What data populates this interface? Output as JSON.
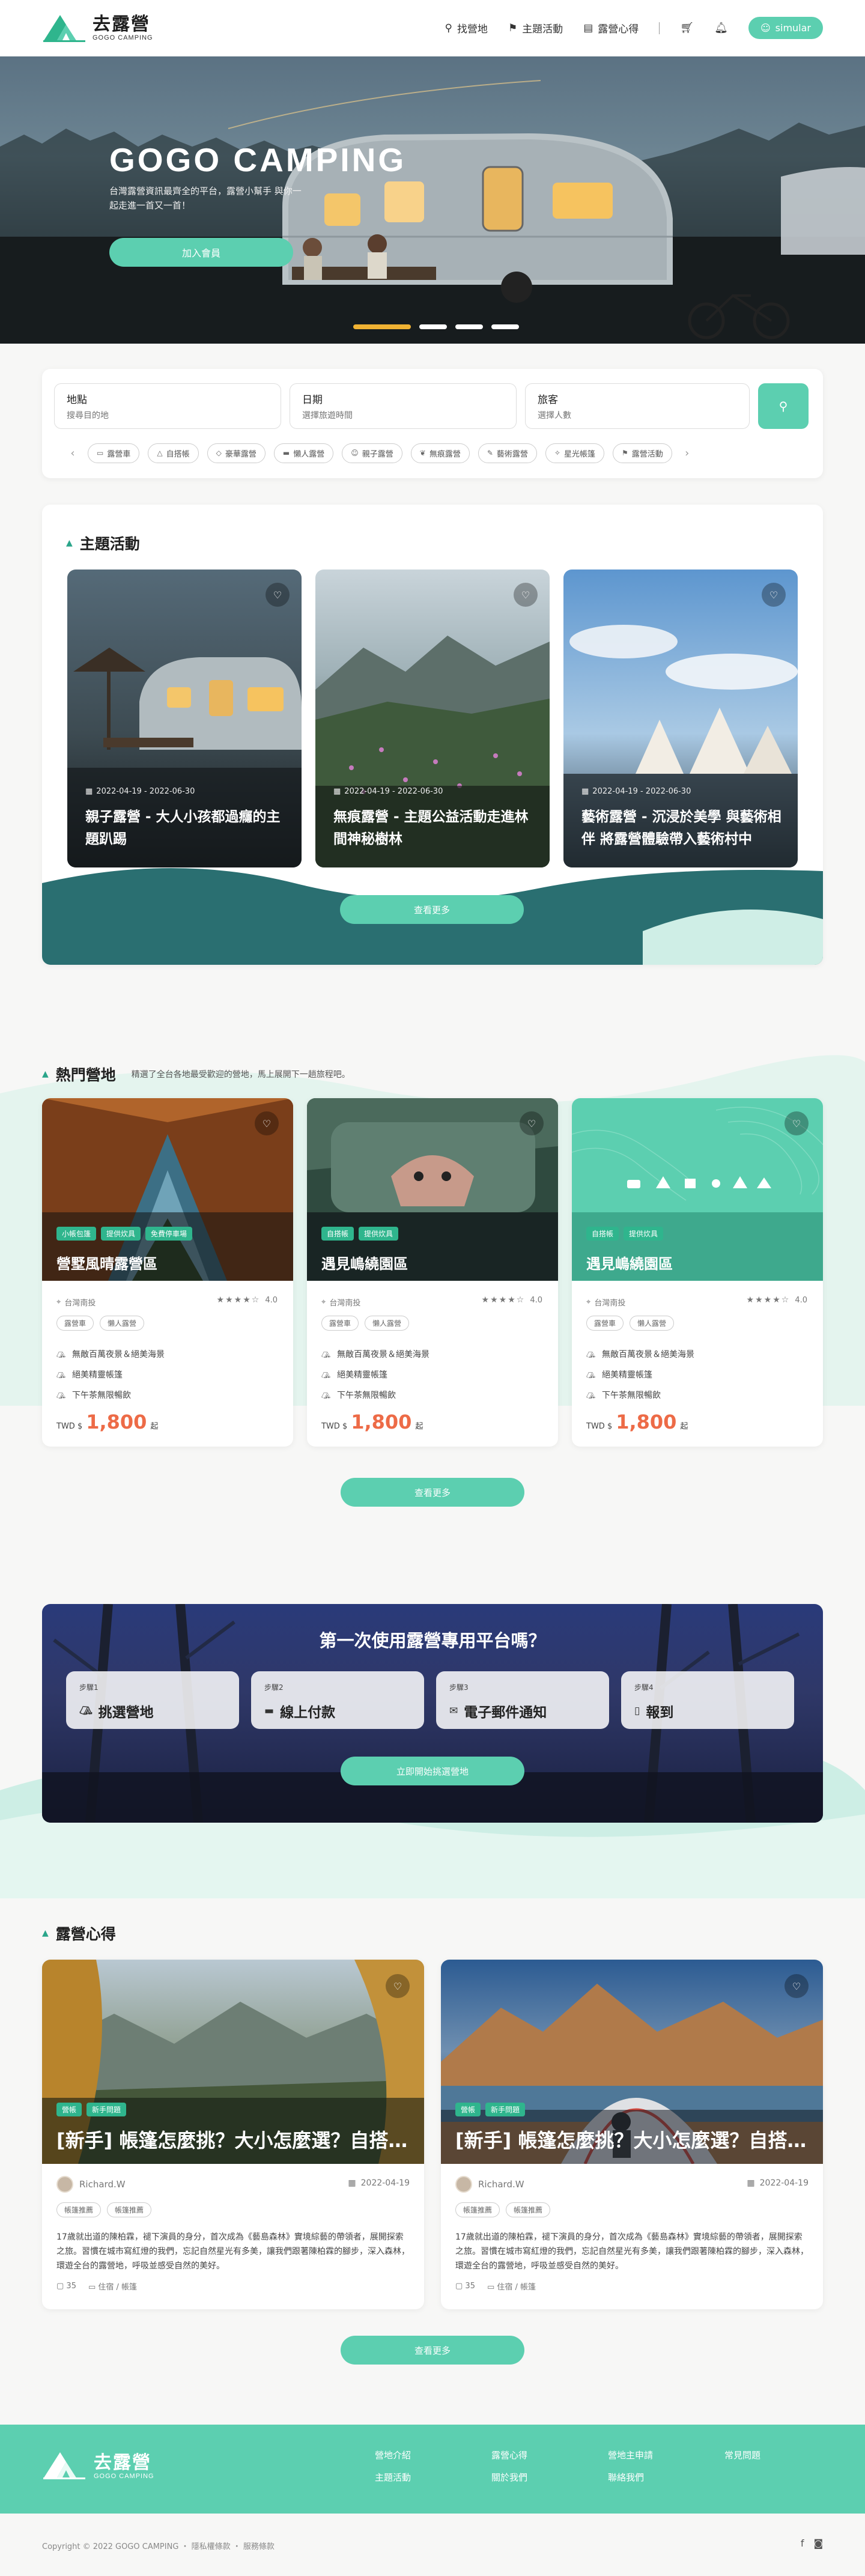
{
  "header": {
    "logo_cn": "去露營",
    "logo_en": "GOGO CAMPING",
    "nav": [
      {
        "label": "找營地",
        "icon": "user-search-icon"
      },
      {
        "label": "主題活動",
        "icon": "flag-icon"
      },
      {
        "label": "露營心得",
        "icon": "notebook-icon"
      }
    ],
    "cart_icon": "cart-icon",
    "bell_icon": "bell-icon",
    "user_label": "simular"
  },
  "hero": {
    "title": "GOGO CAMPING",
    "subtitle": "台灣露營資訊最齊全的平台，露營小幫手 與你一起走進一首又一首！",
    "button": "加入會員",
    "slides_count": 4,
    "active_slide": 1
  },
  "search": {
    "fields": [
      {
        "label": "地點",
        "placeholder": "搜尋目的地"
      },
      {
        "label": "日期",
        "placeholder": "選擇旅遊時間"
      },
      {
        "label": "旅客",
        "placeholder": "選擇人數"
      }
    ],
    "chips": [
      "露營車",
      "自搭帳",
      "豪華露營",
      "懶人露營",
      "親子露營",
      "無痕露營",
      "藝術露營",
      "星光帳篷",
      "露營活動"
    ]
  },
  "theme": {
    "title": "主題活動",
    "items": [
      {
        "date": "2022-04-19 - 2022-06-30",
        "title": "親子露營 - 大人小孩都過癮的主題趴踢"
      },
      {
        "date": "2022-04-19 - 2022-06-30",
        "title": "無痕露營 - 主題公益活動走進林間神秘樹林"
      },
      {
        "date": "2022-04-19 - 2022-06-30",
        "title": "藝術露營 - 沉浸於美學 與藝術相伴 將露營體驗帶入藝術村中"
      }
    ],
    "more": "查看更多"
  },
  "hot": {
    "title": "熱門營地",
    "note": "精選了全台各地最受歡迎的營地，馬上展開下一趟旅程吧。",
    "camps": [
      {
        "tags": [
          "小帳包篷",
          "提供炊具",
          "免費停車場"
        ],
        "name": "營墅風晴露營區",
        "location": "台灣南投",
        "rating": "4.0",
        "stars": "★★★★☆",
        "facilities": [
          "露營車",
          "懶人露營"
        ],
        "features": [
          "無敵百萬夜景＆絕美海景",
          "絕美精靈帳篷",
          "下午茶無限暢飲"
        ],
        "currency": "TWD $",
        "price": "1,800",
        "unit": "起"
      },
      {
        "tags": [
          "自搭帳",
          "提供炊具"
        ],
        "name": "遇見嶋繞園區",
        "location": "台灣南投",
        "rating": "4.0",
        "stars": "★★★★☆",
        "facilities": [
          "露營車",
          "懶人露營"
        ],
        "features": [
          "無敵百萬夜景＆絕美海景",
          "絕美精靈帳篷",
          "下午茶無限暢飲"
        ],
        "currency": "TWD $",
        "price": "1,800",
        "unit": "起"
      },
      {
        "tags": [
          "自搭帳",
          "提供炊具"
        ],
        "name": "遇見嶋繞園區",
        "location": "台灣南投",
        "rating": "4.0",
        "stars": "★★★★☆",
        "facilities": [
          "露營車",
          "懶人露營"
        ],
        "features": [
          "無敵百萬夜景＆絕美海景",
          "絕美精靈帳篷",
          "下午茶無限暢飲"
        ],
        "currency": "TWD $",
        "price": "1,800",
        "unit": "起"
      }
    ],
    "more": "查看更多"
  },
  "first_use": {
    "title": "第一次使用露營專用平台嗎？",
    "steps": [
      {
        "no": "步驟1",
        "title": "挑選營地",
        "icon": "tent-icon"
      },
      {
        "no": "步驟2",
        "title": "線上付款",
        "icon": "card-icon"
      },
      {
        "no": "步驟3",
        "title": "電子郵件通知",
        "icon": "mail-icon"
      },
      {
        "no": "步驟4",
        "title": "報到",
        "icon": "checkin-icon"
      }
    ],
    "button": "立即開始挑選營地"
  },
  "experience": {
    "title": "露營心得",
    "posts": [
      {
        "tags": [
          "營帳",
          "新手問題"
        ],
        "title": "[新手] 帳篷怎麼挑？大小怎麼選？自搭帳篷新手指南",
        "author": "Richard.W",
        "date": "2022-04-19",
        "facilities": [
          "帳篷推薦",
          "帳篷推薦"
        ],
        "body": "17歲就出道的陳柏霖，褪下演員的身分，首次成為《藝島森林》實境綜藝的帶領者，展開探索之旅。習慣在城市寫紅燈的我們，忘記自然星光有多美，讓我們跟著陳柏霖的腳步，深入森林，環遊全台的露營地，呼吸並感受自然的美好。",
        "comments": "35",
        "category": "住宿 / 帳篷"
      },
      {
        "tags": [
          "營帳",
          "新手問題"
        ],
        "title": "[新手] 帳篷怎麼挑？大小怎麼選？自搭帳篷新手指南",
        "author": "Richard.W",
        "date": "2022-04-19",
        "facilities": [
          "帳篷推薦",
          "帳篷推薦"
        ],
        "body": "17歲就出道的陳柏霖，褪下演員的身分，首次成為《藝島森林》實境綜藝的帶領者，展開探索之旅。習慣在城市寫紅燈的我們，忘記自然星光有多美，讓我們跟著陳柏霖的腳步，深入森林，環遊全台的露營地，呼吸並感受自然的美好。",
        "comments": "35",
        "category": "住宿 / 帳篷"
      }
    ],
    "more": "查看更多"
  },
  "footer": {
    "logo_cn": "去露營",
    "logo_en": "GOGO CAMPING",
    "links": [
      "營地介紹",
      "露營心得",
      "營地主申請",
      "常見問題",
      "主題活動",
      "關於我們",
      "聯絡我們",
      ""
    ],
    "copyright": "Copyright © 2022 GOGO CAMPING ・ 隱私權條款 ・ 服務條款",
    "social": [
      "facebook-icon",
      "instagram-icon"
    ]
  },
  "colors": {
    "accent": "#5ccfb0",
    "accent_dark": "#2fb58d",
    "price": "#ed6b47",
    "star_active": "#f0b233"
  }
}
